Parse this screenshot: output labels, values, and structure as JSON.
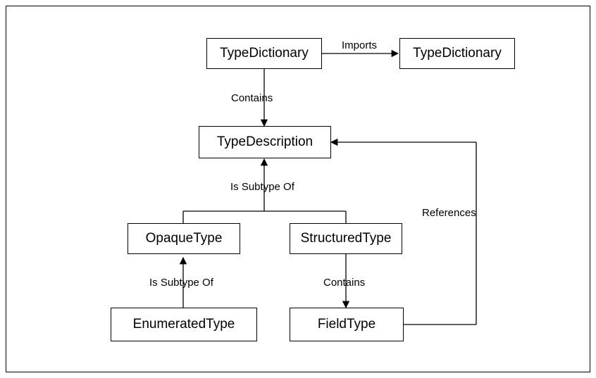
{
  "nodes": {
    "typeDictionary1": "TypeDictionary",
    "typeDictionary2": "TypeDictionary",
    "typeDescription": "TypeDescription",
    "opaqueType": "OpaqueType",
    "structuredType": "StructuredType",
    "enumeratedType": "EnumeratedType",
    "fieldType": "FieldType"
  },
  "edges": {
    "imports": "Imports",
    "contains1": "Contains",
    "isSubtypeOf1": "Is Subtype Of",
    "references": "References",
    "isSubtypeOf2": "Is Subtype Of",
    "contains2": "Contains"
  }
}
